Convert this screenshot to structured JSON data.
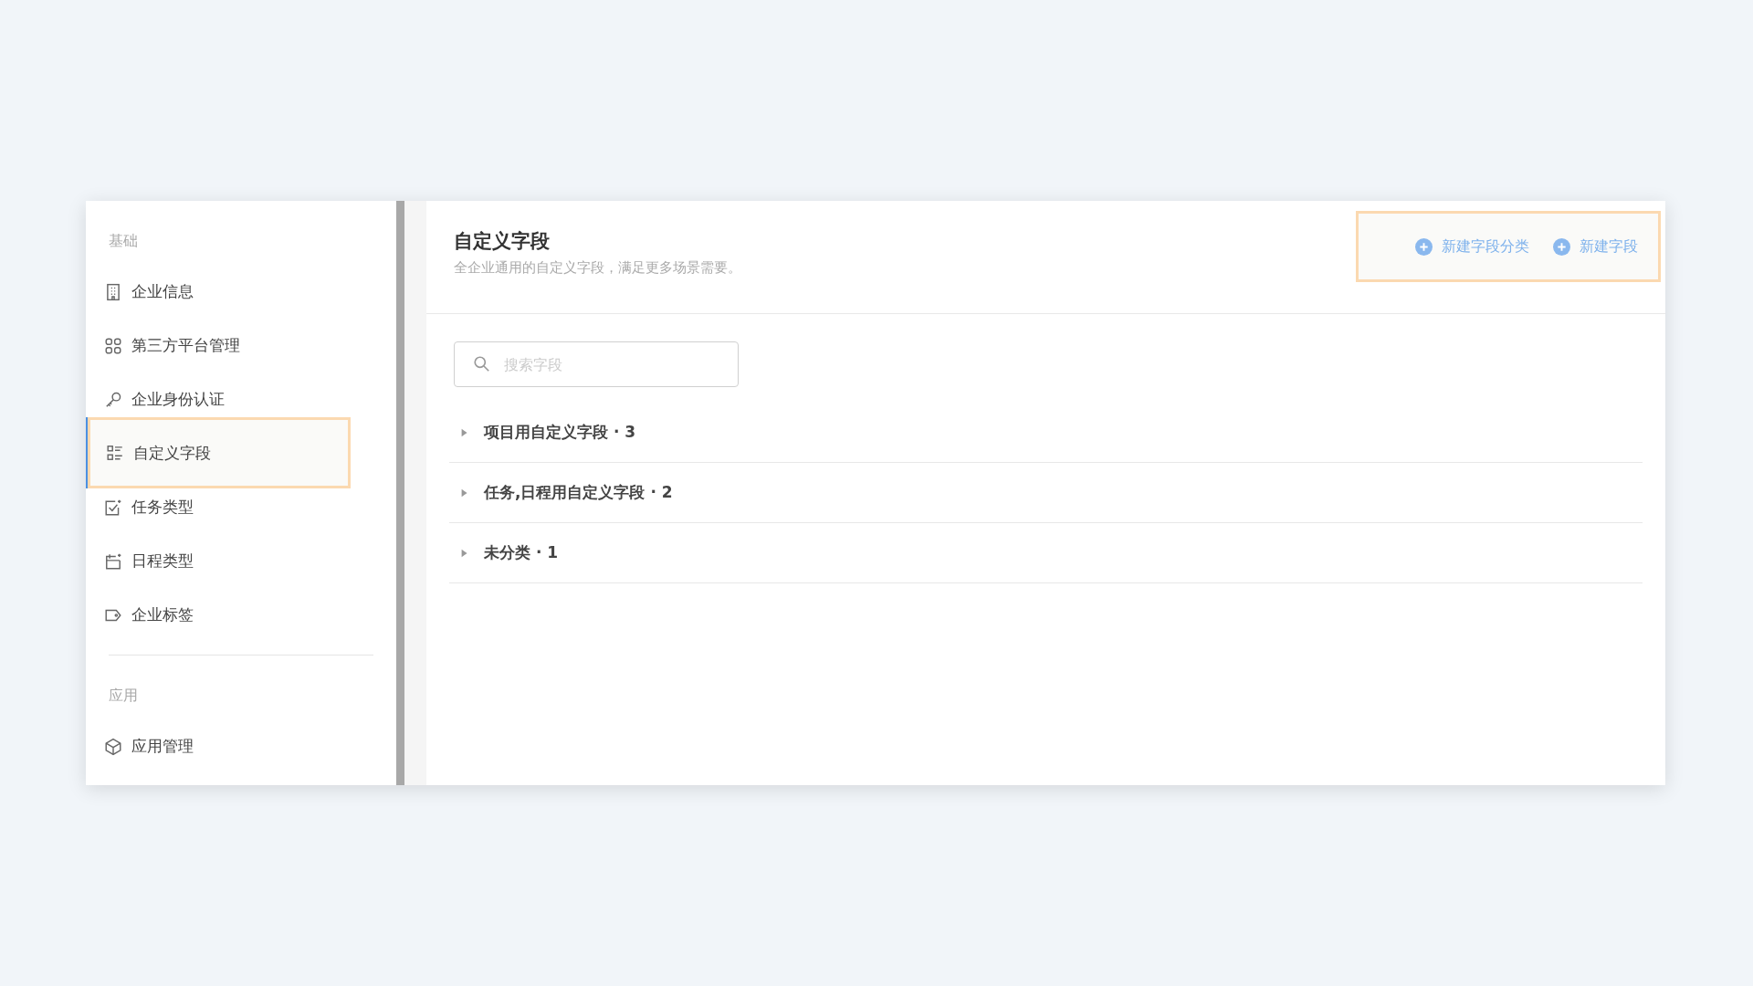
{
  "sidebar": {
    "sections": [
      {
        "title": "基础",
        "items": [
          {
            "label": "企业信息",
            "kind": "building",
            "selected": false
          },
          {
            "label": "第三方平台管理",
            "kind": "grid",
            "selected": false
          },
          {
            "label": "企业身份认证",
            "kind": "key",
            "selected": false
          },
          {
            "label": "自定义字段",
            "kind": "list",
            "selected": true
          },
          {
            "label": "任务类型",
            "kind": "task",
            "selected": false
          },
          {
            "label": "日程类型",
            "kind": "calendar",
            "selected": false
          },
          {
            "label": "企业标签",
            "kind": "tag",
            "selected": false
          }
        ]
      },
      {
        "title": "应用",
        "items": [
          {
            "label": "应用管理",
            "kind": "cube",
            "selected": false
          }
        ]
      }
    ]
  },
  "header": {
    "title": "自定义字段",
    "subtitle": "全企业通用的自定义字段，满足更多场景需要。",
    "actions": [
      "新建字段分类",
      "新建字段"
    ]
  },
  "search": {
    "placeholder": "搜索字段"
  },
  "groups": [
    {
      "label": "项目用自定义字段 · 3",
      "expanded": false
    },
    {
      "label": "任务,日程用自定义字段 · 2",
      "expanded": false
    },
    {
      "label": "未分类 · 1",
      "expanded": false
    }
  ]
}
